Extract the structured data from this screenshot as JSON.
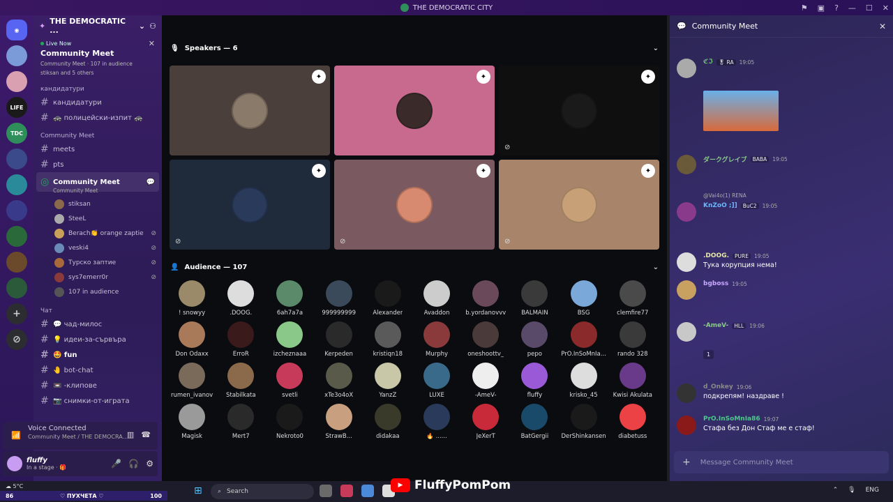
{
  "window": {
    "title": "THE DEMOCRATIC CITY"
  },
  "sidebar": {
    "guild_name": "THE DEMOCRATIC ...",
    "live": {
      "tag": "Live Now",
      "title": "Community Meet",
      "channel": "Community Meet",
      "audience": "107 in audience",
      "others": "stiksan and 5 others"
    },
    "cat_candidates": "кандидатури",
    "channels_top": [
      {
        "label": "кандидатури"
      },
      {
        "label": "🚓 полицейски-изпит 🚓"
      }
    ],
    "cat_meet": "Community Meet",
    "channels_meet": [
      {
        "label": "meets"
      },
      {
        "label": "pts"
      }
    ],
    "stage": {
      "label": "Community Meet",
      "sub": "Community Meet"
    },
    "voice_users": [
      {
        "name": "stiksan",
        "muted": false
      },
      {
        "name": "SteeL",
        "muted": false
      },
      {
        "name": "Berach👏 orange zaptie",
        "muted": true
      },
      {
        "name": "veski4",
        "muted": true
      },
      {
        "name": "Турско заптие",
        "muted": true
      },
      {
        "name": "sys7emerr0r",
        "muted": true
      },
      {
        "name": "107 in audience",
        "muted": false
      }
    ],
    "cat_chat": "Чат",
    "channels_chat": [
      {
        "label": "💬 чад-милос",
        "active": false
      },
      {
        "label": "💡 идеи-за-сървъра",
        "active": false
      },
      {
        "label": "🤩 fun",
        "active": true
      },
      {
        "label": "🤚 bot-chat",
        "active": false
      },
      {
        "label": "📼 -клипове",
        "active": false
      },
      {
        "label": "📷 снимки-от-играта",
        "active": false
      }
    ],
    "voice": {
      "title": "Voice Connected",
      "sub": "Community Meet / THE DEMOCRA..."
    },
    "user": {
      "name": "fluffy",
      "status": "In a stage · 🎁"
    }
  },
  "main": {
    "speakers_title": "Speakers — 6",
    "speakers": [
      {
        "bg": "#4a3f3a",
        "av": "#8a7a6a",
        "muted": false
      },
      {
        "bg": "#c86a8e",
        "av": "#3a2a2a",
        "muted": false
      },
      {
        "bg": "#0f0f10",
        "av": "#1a1a1a",
        "muted": true
      },
      {
        "bg": "#1f2a3a",
        "av": "#2a3a5a",
        "muted": true
      },
      {
        "bg": "#7a5a60",
        "av": "#d88a70",
        "muted": true
      },
      {
        "bg": "#a8856a",
        "av": "#c8a078",
        "muted": true
      }
    ],
    "audience_title": "Audience — 107",
    "audience": [
      {
        "name": "! snowyy",
        "c": "#9a8a6a"
      },
      {
        "name": ".DOOG.",
        "c": "#dddddd"
      },
      {
        "name": "6ah7a7a",
        "c": "#5a8a6a"
      },
      {
        "name": "999999999",
        "c": "#3a4a5a"
      },
      {
        "name": "Alexander",
        "c": "#1a1a1a"
      },
      {
        "name": "Avaddon",
        "c": "#cccccc"
      },
      {
        "name": "b.yordanovvv",
        "c": "#6a4a5a"
      },
      {
        "name": "BALMAIN",
        "c": "#3a3a3a"
      },
      {
        "name": "BSG",
        "c": "#7aa8d8"
      },
      {
        "name": "clemfire77",
        "c": "#4a4a4a"
      },
      {
        "name": "Don Odaxx",
        "c": "#a87a5a"
      },
      {
        "name": "ErroR",
        "c": "#3a1a1a"
      },
      {
        "name": "izcheznaaa",
        "c": "#8ac88a"
      },
      {
        "name": "Kerpeden",
        "c": "#2a2a2a"
      },
      {
        "name": "kristiqn18",
        "c": "#5a5a5a"
      },
      {
        "name": "Murphy",
        "c": "#8a3a3a"
      },
      {
        "name": "oneshoottv_",
        "c": "#4a3a3a"
      },
      {
        "name": "pepo",
        "c": "#5a4a6a"
      },
      {
        "name": "PrO.InSoMnIa...",
        "c": "#8a2a2a"
      },
      {
        "name": "rando 328",
        "c": "#3a3a3a"
      },
      {
        "name": "rumen_ivanov",
        "c": "#7a6a5a"
      },
      {
        "name": "Stabilkata",
        "c": "#8a6a4a"
      },
      {
        "name": "svetli",
        "c": "#c83a5a"
      },
      {
        "name": "xTe3o4oX",
        "c": "#5a5a4a"
      },
      {
        "name": "YanzZ",
        "c": "#c8c8a8"
      },
      {
        "name": "LUXE",
        "c": "#3a6a8a"
      },
      {
        "name": "-AmeV-",
        "c": "#eeeeee"
      },
      {
        "name": "fluffy",
        "c": "#9a5ad8"
      },
      {
        "name": "krisko_45",
        "c": "#dddddd"
      },
      {
        "name": "Kwisi Akulata",
        "c": "#6a3a8a"
      },
      {
        "name": "Magisk",
        "c": "#9a9a9a"
      },
      {
        "name": "Mert7",
        "c": "#2a2a2a"
      },
      {
        "name": "Nekroto0",
        "c": "#1a1a1a"
      },
      {
        "name": "StrawB...",
        "c": "#c8a080"
      },
      {
        "name": "didakaa",
        "c": "#3a3a2a"
      },
      {
        "name": "🔥 ......",
        "c": "#2a3a5a"
      },
      {
        "name": "JeXerT",
        "c": "#c82a3a"
      },
      {
        "name": "BatGergii",
        "c": "#1a4a6a"
      },
      {
        "name": "DerShinkansen",
        "c": "#1a1a1a"
      },
      {
        "name": "diabetuss",
        "c": "#ed4245"
      }
    ]
  },
  "chat": {
    "title": "Community Meet",
    "messages": [
      {
        "name": "ℭℑ",
        "tag": "🎖 RA",
        "time": "19:05",
        "text": "",
        "color": "#7ad87a"
      },
      {
        "name": "ダークグレイブ",
        "tag": "BABA",
        "time": "19:05",
        "text": "",
        "color": "#8ac88a"
      },
      {
        "name": "KnZoO ;]]",
        "tag": "BuC2",
        "time": "19:05",
        "text": "",
        "color": "#6ab8ff",
        "reply": "@Vai4o(1) RENA"
      },
      {
        "name": ".DOOG.",
        "tag": "PURE",
        "time": "19:05",
        "text": "Тука корупция нема!",
        "color": "#e8e8a8"
      },
      {
        "name": "bgboss",
        "tag": "",
        "time": "19:05",
        "text": "",
        "color": "#c8a8ff"
      },
      {
        "name": "-AmeV-",
        "tag": "HLL",
        "time": "19:06",
        "text": "",
        "color": "#8ac88a",
        "reaction": "1"
      },
      {
        "name": "d_Onkey",
        "tag": "",
        "time": "19:06",
        "text": "подкрепям! наздраве !",
        "color": "#8a8a8a"
      },
      {
        "name": "PrO.InSoMnIa86",
        "tag": "",
        "time": "19:07",
        "text": "Стафа без Дон Стаф ме е стаф!",
        "color": "#4ac88a"
      }
    ],
    "input_placeholder": "Message Community Meet"
  },
  "taskbar": {
    "weather": "5°C",
    "search": "Search",
    "lang": "ENG"
  },
  "overlay": {
    "left": "86",
    "center": "♡ ПУХЧЕТА ♡",
    "right": "100",
    "brand": "FluffyPomPom"
  }
}
